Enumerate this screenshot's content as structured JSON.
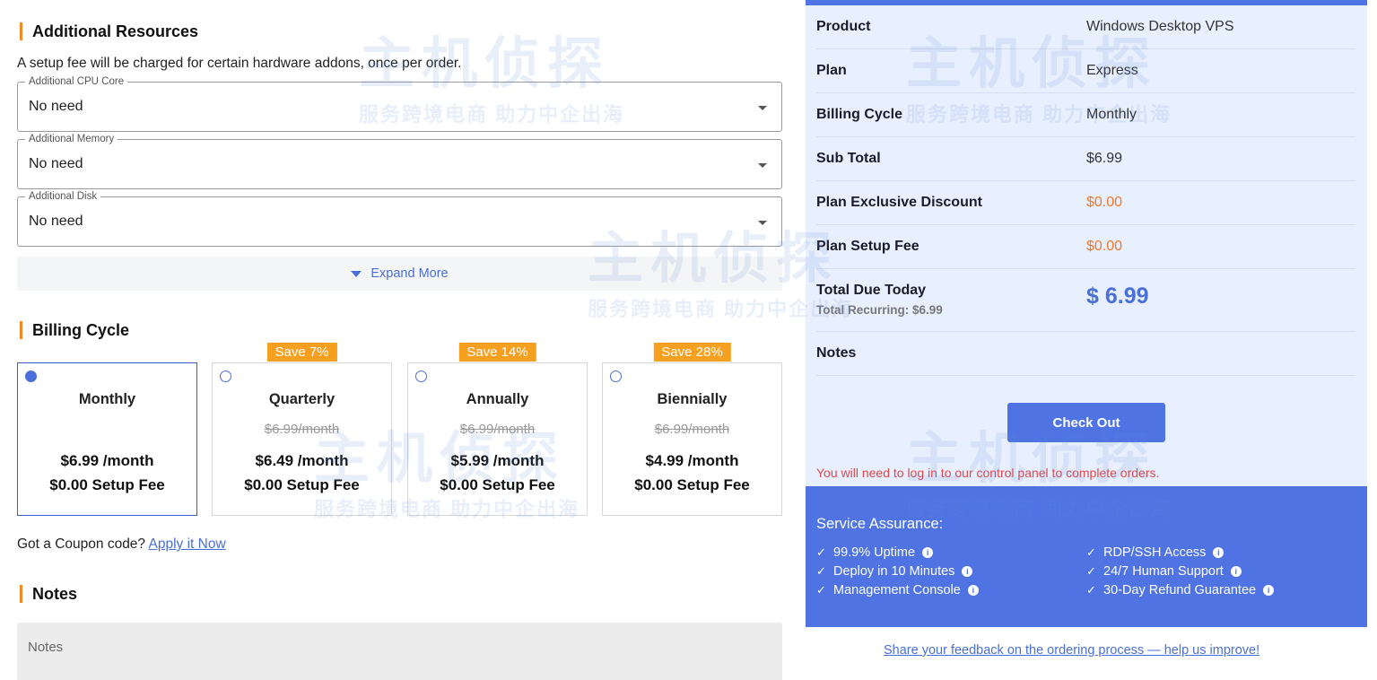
{
  "resources": {
    "title": "Additional Resources",
    "subtext": "A setup fee will be charged for certain hardware addons, once per order.",
    "fields": [
      {
        "legend": "Additional CPU Core",
        "value": "No need"
      },
      {
        "legend": "Additional Memory",
        "value": "No need"
      },
      {
        "legend": "Additional Disk",
        "value": "No need"
      }
    ],
    "expand_label": "Expand More"
  },
  "billing": {
    "title": "Billing Cycle",
    "options": [
      {
        "name": "Monthly",
        "badge": "",
        "old_price": "",
        "price": "$6.99 /month",
        "setup": "$0.00 Setup Fee",
        "selected": true
      },
      {
        "name": "Quarterly",
        "badge": "Save 7%",
        "old_price": "$6.99/month",
        "price": "$6.49 /month",
        "setup": "$0.00 Setup Fee",
        "selected": false
      },
      {
        "name": "Annually",
        "badge": "Save 14%",
        "old_price": "$6.99/month",
        "price": "$5.99 /month",
        "setup": "$0.00 Setup Fee",
        "selected": false
      },
      {
        "name": "Biennially",
        "badge": "Save 28%",
        "old_price": "$6.99/month",
        "price": "$4.99 /month",
        "setup": "$0.00 Setup Fee",
        "selected": false
      }
    ]
  },
  "coupon": {
    "text": "Got a Coupon code?",
    "link": "Apply it Now"
  },
  "notes": {
    "title": "Notes",
    "placeholder": "Notes"
  },
  "summary": {
    "rows": [
      {
        "key": "Product",
        "value": "Windows Desktop VPS"
      },
      {
        "key": "Plan",
        "value": "Express"
      },
      {
        "key": "Billing Cycle",
        "value": "Monthly"
      },
      {
        "key": "Sub Total",
        "value": "$6.99"
      },
      {
        "key": "Plan Exclusive Discount",
        "value": "$0.00"
      },
      {
        "key": "Plan Setup Fee",
        "value": "$0.00"
      }
    ],
    "total_label": "Total Due Today",
    "total_value": "$ 6.99",
    "recurring": "Total Recurring: $6.99",
    "notes_label": "Notes",
    "checkout_label": "Check Out",
    "login_note": "You will need to log in to our control panel to complete orders."
  },
  "assurance": {
    "title": "Service Assurance:",
    "left": [
      "99.9% Uptime",
      "Deploy in 10 Minutes",
      "Management Console"
    ],
    "right": [
      "RDP/SSH Access",
      "24/7 Human Support",
      "30-Day Refund Guarantee"
    ]
  },
  "feedback": "Share your feedback on the ordering process — help us improve!",
  "watermark": {
    "main": "主机侦探",
    "sub": "服务跨境电商 助力中企出海"
  },
  "colors": {
    "accent": "#4f73e3",
    "orange": "#f07a2a",
    "badge": "#f7a020",
    "panel": "#e8efff"
  }
}
